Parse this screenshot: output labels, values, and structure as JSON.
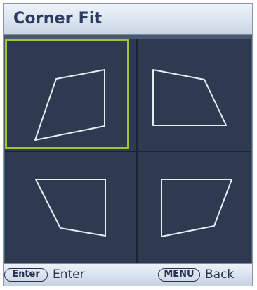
{
  "title": "Corner Fit",
  "cells": [
    {
      "id": "top-left",
      "selected": true,
      "icon": "corner-top-left-icon"
    },
    {
      "id": "top-right",
      "selected": false,
      "icon": "corner-top-right-icon"
    },
    {
      "id": "bottom-left",
      "selected": false,
      "icon": "corner-bottom-left-icon"
    },
    {
      "id": "bottom-right",
      "selected": false,
      "icon": "corner-bottom-right-icon"
    }
  ],
  "footer": {
    "enter_key": "Enter",
    "enter_label": "Enter",
    "menu_key": "MENU",
    "back_label": "Back"
  },
  "colors": {
    "selection": "#a3c132",
    "shape_stroke": "#e6ecf4",
    "panel_bg": "#2d3a4f",
    "title_text": "#2b3c5e"
  }
}
